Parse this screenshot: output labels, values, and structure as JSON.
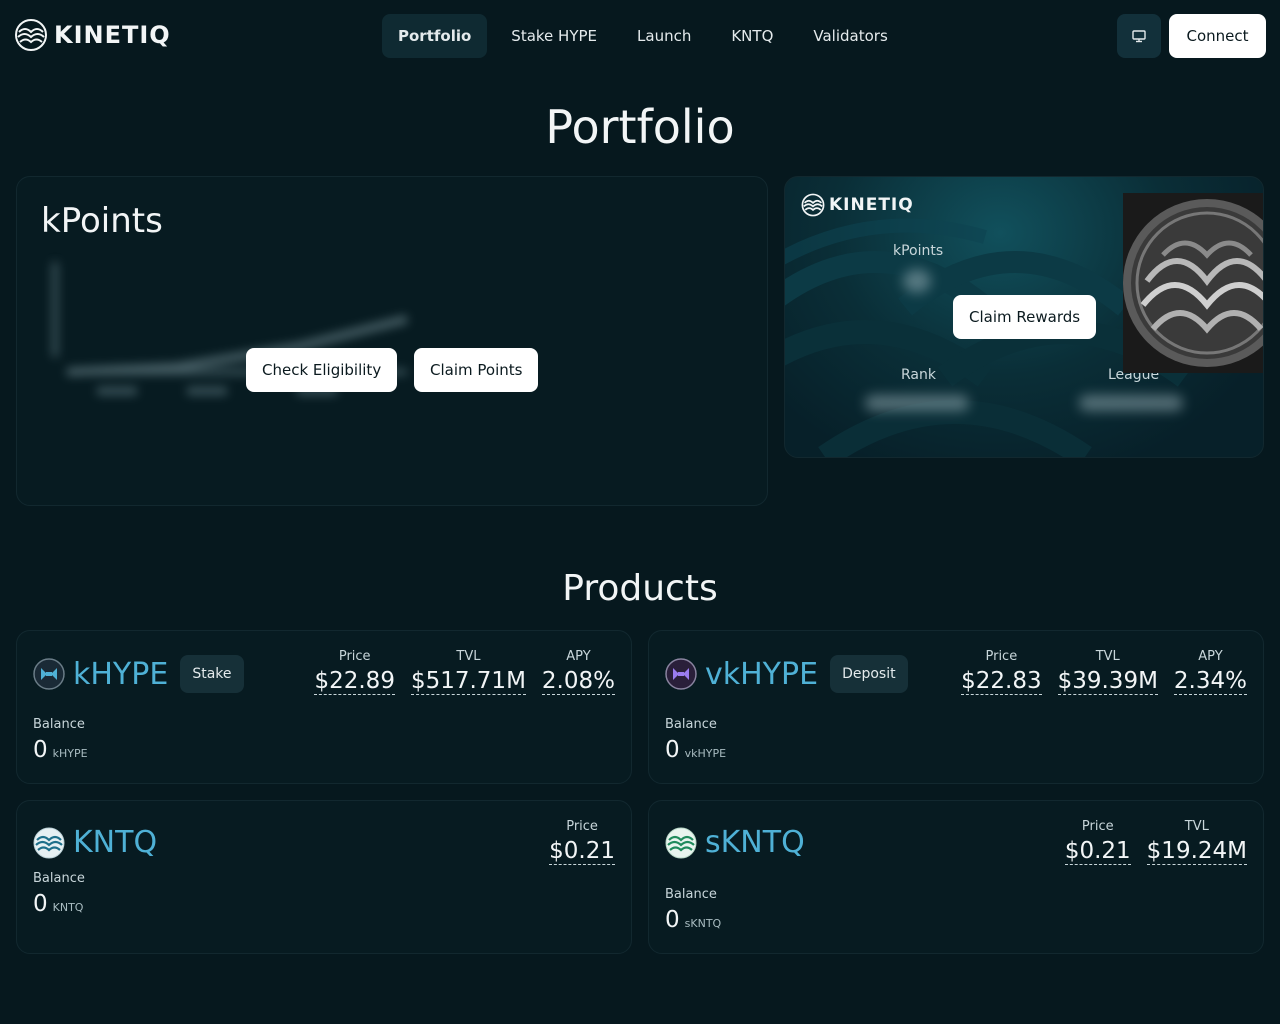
{
  "header": {
    "logo_text": "KINETIQ",
    "nav": [
      {
        "label": "Portfolio",
        "active": true
      },
      {
        "label": "Stake HYPE",
        "active": false
      },
      {
        "label": "Launch",
        "active": false
      },
      {
        "label": "KNTQ",
        "active": false
      },
      {
        "label": "Validators",
        "active": false
      }
    ],
    "display_icon": "monitor-icon",
    "connect_label": "Connect"
  },
  "page_title": "Portfolio",
  "kpoints": {
    "title": "kPoints",
    "check_eligibility_label": "Check Eligibility",
    "claim_points_label": "Claim Points"
  },
  "rewards_card": {
    "logo_text": "KINETIQ",
    "kpoints_label": "kPoints",
    "claim_rewards_label": "Claim Rewards",
    "rank_label": "Rank",
    "league_label": "League"
  },
  "products_title": "Products",
  "products": [
    {
      "name": "kHYPE",
      "action": "Stake",
      "icon": "khype-icon",
      "stats": [
        {
          "label": "Price",
          "value": "$22.89"
        },
        {
          "label": "TVL",
          "value": "$517.71M"
        },
        {
          "label": "APY",
          "value": "2.08%"
        }
      ],
      "balance_label": "Balance",
      "balance": "0",
      "unit": "kHYPE"
    },
    {
      "name": "vkHYPE",
      "action": "Deposit",
      "icon": "vkhype-icon",
      "stats": [
        {
          "label": "Price",
          "value": "$22.83"
        },
        {
          "label": "TVL",
          "value": "$39.39M"
        },
        {
          "label": "APY",
          "value": "2.34%"
        }
      ],
      "balance_label": "Balance",
      "balance": "0",
      "unit": "vkHYPE"
    },
    {
      "name": "KNTQ",
      "action": null,
      "icon": "kntq-icon",
      "stats": [
        {
          "label": "Price",
          "value": "$0.21"
        }
      ],
      "balance_label": "Balance",
      "balance": "0",
      "unit": "KNTQ"
    },
    {
      "name": "sKNTQ",
      "action": null,
      "icon": "skntq-icon",
      "stats": [
        {
          "label": "Price",
          "value": "$0.21"
        },
        {
          "label": "TVL",
          "value": "$19.24M"
        }
      ],
      "balance_label": "Balance",
      "balance": "0",
      "unit": "sKNTQ"
    }
  ],
  "colors": {
    "background": "#06181e",
    "accent": "#4fb1d6",
    "panel_border": "#12282f",
    "button_bg": "#ffffff"
  }
}
